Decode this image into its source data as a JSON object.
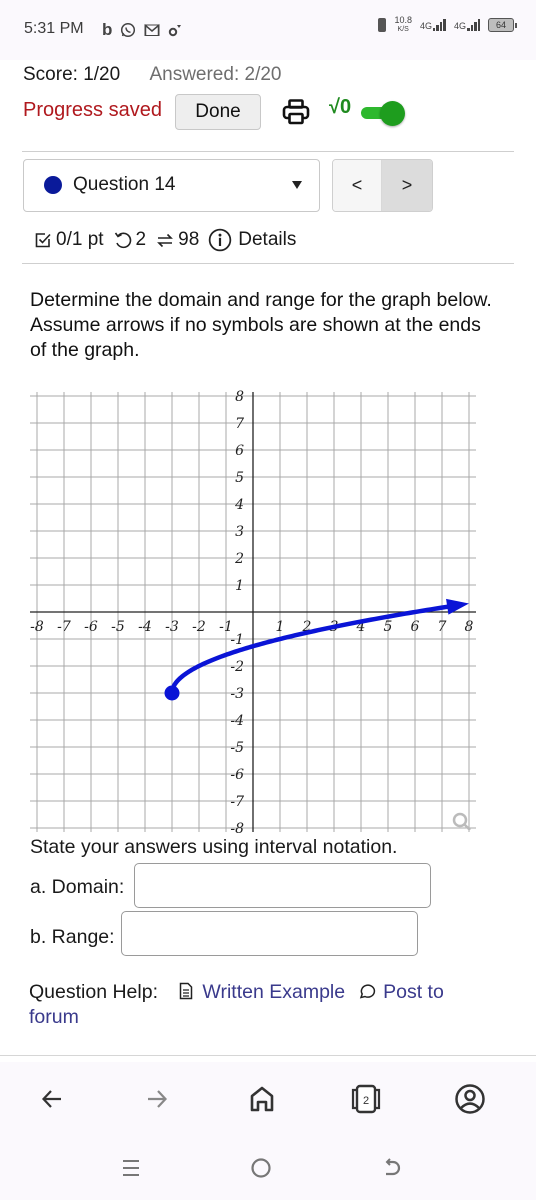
{
  "status_bar": {
    "time": "5:31 PM",
    "left_icons": [
      "b-app-icon",
      "whatsapp-icon",
      "gmail-icon",
      "settings-notification-icon"
    ],
    "net_speed_value": "10.8",
    "net_speed_unit": "K/S",
    "sim1_label": "4G",
    "sim2_label": "4G",
    "battery": "64"
  },
  "header": {
    "score": "Score: 1/20",
    "answered": "Answered: 2/20",
    "progress_saved": "Progress saved",
    "done_label": "Done",
    "math_toggle_label": "√0",
    "math_toggle_on": true,
    "colors": {
      "progress_saved": "#b0191e",
      "toggle": "#1e9d1e"
    }
  },
  "question_nav": {
    "selected": "Question 14",
    "status_dot_color": "#0a1a9a",
    "prev_label": "<",
    "next_label": ">"
  },
  "meta": {
    "points": "0/1 pt",
    "retries": "2",
    "attempts": "98",
    "details_label": "Details"
  },
  "prompt": {
    "line1": "Determine the domain and range for the graph below.",
    "line2": "Assume arrows if no symbols are shown at the ends of the graph."
  },
  "chart_data": {
    "type": "line",
    "title": "",
    "xlabel": "",
    "ylabel": "",
    "xlim": [
      -8,
      8
    ],
    "ylim": [
      -8,
      8
    ],
    "grid": true,
    "x_ticks": [
      -8,
      -7,
      -6,
      -5,
      -4,
      -3,
      -2,
      -1,
      1,
      2,
      3,
      4,
      5,
      6,
      7,
      8
    ],
    "y_ticks": [
      8,
      7,
      6,
      5,
      4,
      3,
      2,
      1,
      -1,
      -2,
      -3,
      -4,
      -5,
      -6,
      -7,
      -8
    ],
    "series": [
      {
        "name": "curve",
        "color": "#0a14d6",
        "function": "sqrt(x+3)-3",
        "start_point": {
          "x": -3,
          "y": -3,
          "marker": "closed-dot"
        },
        "end": {
          "x": 8,
          "y": 0.32,
          "marker": "arrow"
        },
        "points": [
          [
            -3,
            -3
          ],
          [
            -2.75,
            -2.5
          ],
          [
            -2,
            -2
          ],
          [
            -1,
            -1.59
          ],
          [
            0,
            -1.27
          ],
          [
            1,
            -1
          ],
          [
            2,
            -0.76
          ],
          [
            3,
            -0.55
          ],
          [
            4,
            -0.35
          ],
          [
            5,
            -0.17
          ],
          [
            6,
            0
          ],
          [
            7,
            0.16
          ],
          [
            8,
            0.32
          ]
        ]
      }
    ]
  },
  "answers": {
    "instruction": "State your answers using interval notation.",
    "domain_label": "a. Domain:",
    "domain_value": "",
    "range_label": "b. Range:",
    "range_value": ""
  },
  "help": {
    "label": "Question Help:",
    "written_example": "Written Example",
    "post_to_forum": "Post to forum"
  },
  "browser_bar": {
    "tab_count": "2"
  }
}
